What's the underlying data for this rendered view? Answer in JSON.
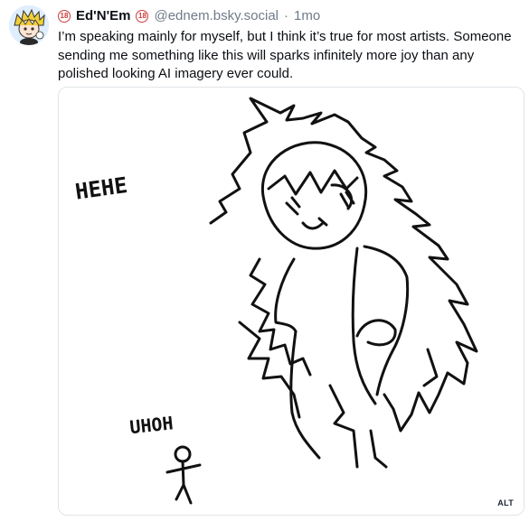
{
  "post": {
    "author": {
      "display_name": "Ed'N'Em",
      "handle": "@ednem.bsky.social",
      "badge_text": "18",
      "badge_color": "#d03b3b"
    },
    "separator": "·",
    "timestamp": "1mo",
    "text": "I’m speaking mainly for myself, but I think it’s true for most artists. Someone sending me something like this will sparks infinitely more joy than any polished looking AI imagery ever could.",
    "image": {
      "drawn_text_1": "HEHE",
      "drawn_text_2": "UHOH",
      "alt_label": "ALT"
    }
  },
  "colors": {
    "text_primary": "#0b0f14",
    "text_secondary": "#6f7b89",
    "border": "#dfe5ea"
  }
}
